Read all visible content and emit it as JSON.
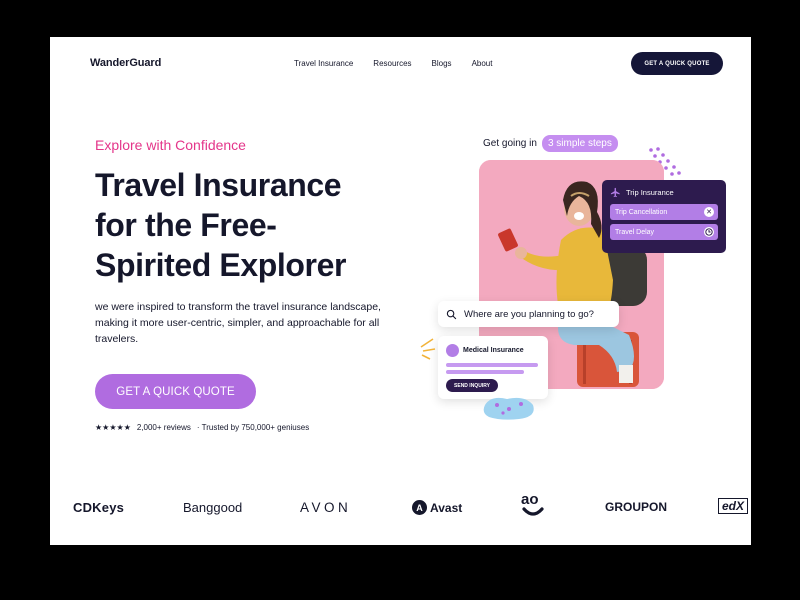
{
  "brand": "WanderGuard",
  "nav": {
    "links": [
      "Travel Insurance",
      "Resources",
      "Blogs",
      "About"
    ],
    "cta": "GET A QUICK QUOTE"
  },
  "hero": {
    "eyebrow": "Explore with Confidence",
    "headline_lines": [
      "Travel Insurance",
      "for the Free-",
      "Spirited Explorer"
    ],
    "description": "we were inspired to transform the travel insurance landscape, making it more user-centric, simpler, and approachable for all travelers.",
    "cta": "GET A QUICK QUOTE",
    "stars": "★★★★★",
    "reviews": "2,000+ reviews",
    "trusted": "· Trusted by 750,000+ geniuses"
  },
  "illustration": {
    "steps_label": "Get going in",
    "steps_pill": "3 simple steps",
    "trip_card": {
      "title": "Trip Insurance",
      "rows": [
        {
          "label": "Trip Cancellation",
          "icon": "close-icon"
        },
        {
          "label": "Travel Delay",
          "icon": "clock-icon"
        }
      ]
    },
    "search_text": "Where are you planning to go?",
    "medical_card": {
      "title": "Medical Insurance",
      "button": "SEND INQUIRY"
    }
  },
  "brands": [
    "CDKeys",
    "Banggood",
    "AVON",
    "Avast",
    "GROUPON",
    "edX"
  ],
  "colors": {
    "accent_pink": "#e4358a",
    "accent_purple": "#b06ce0",
    "navy": "#151638",
    "deep_purple": "#2d1b4e"
  }
}
